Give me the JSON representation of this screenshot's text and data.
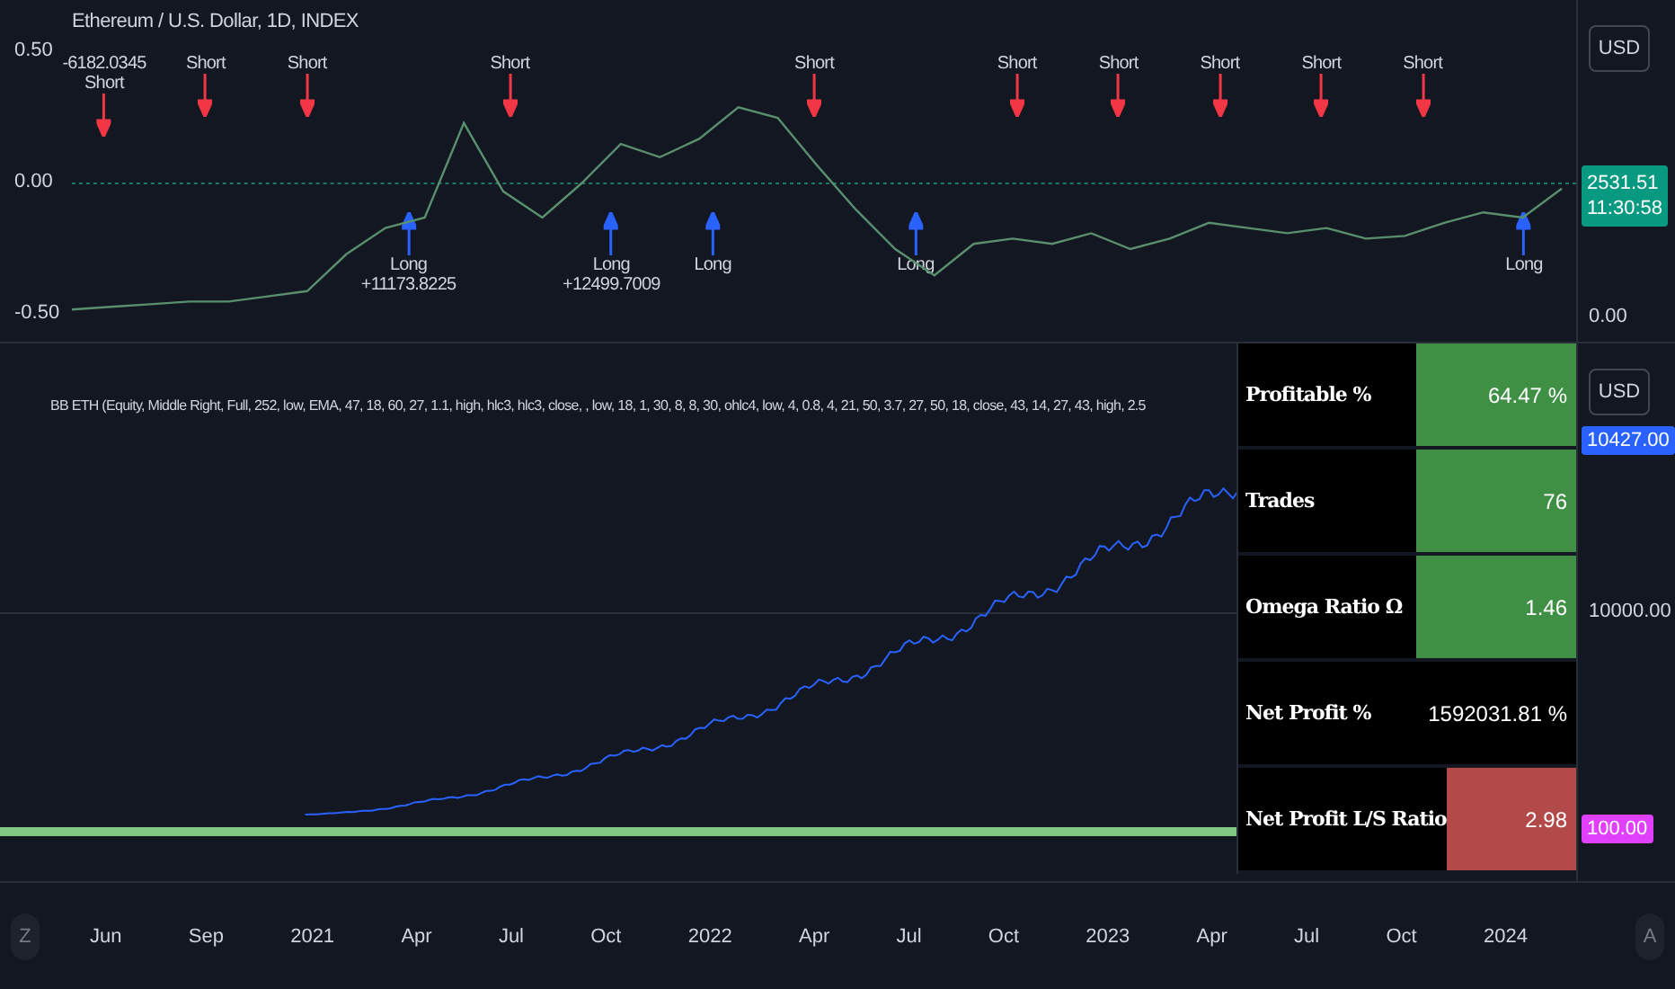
{
  "top_pane": {
    "symbol_legend": "Ethereum / U.S. Dollar, 1D, INDEX",
    "chart_data": {
      "type": "line",
      "ylim": [
        -0.5,
        0.5
      ],
      "yticks": [
        {
          "value": 0.5,
          "label": "0.50"
        },
        {
          "value": 0,
          "label": "0.00"
        },
        {
          "value": -0.5,
          "label": "-0.50"
        }
      ],
      "series": [
        {
          "color": "#5a8f6e",
          "values": [
            -0.48,
            -0.47,
            -0.46,
            -0.45,
            -0.45,
            -0.43,
            -0.41,
            -0.27,
            -0.17,
            -0.13,
            0.23,
            -0.03,
            -0.13,
            0.0,
            0.15,
            0.1,
            0.17,
            0.29,
            0.25,
            0.07,
            -0.1,
            -0.25,
            -0.35,
            -0.23,
            -0.21,
            -0.23,
            -0.19,
            -0.25,
            -0.21,
            -0.15,
            -0.17,
            -0.19,
            -0.17,
            -0.21,
            -0.2,
            -0.15,
            -0.11,
            -0.13,
            -0.02
          ]
        }
      ]
    },
    "currency_button": "USD",
    "price_tag": {
      "price": "2531.51",
      "countdown": "11:30:58"
    },
    "zero_label": "0.00",
    "signals": [
      {
        "kind": "short",
        "label": "Short",
        "pnl": "-6182.0345"
      },
      {
        "kind": "short",
        "label": "Short"
      },
      {
        "kind": "short",
        "label": "Short"
      },
      {
        "kind": "long",
        "label": "Long",
        "pnl": "+11173.8225"
      },
      {
        "kind": "short",
        "label": "Short"
      },
      {
        "kind": "long",
        "label": "Long",
        "pnl": "+12499.7009"
      },
      {
        "kind": "long",
        "label": "Long"
      },
      {
        "kind": "short",
        "label": "Short"
      },
      {
        "kind": "long",
        "label": "Long"
      },
      {
        "kind": "short",
        "label": "Short"
      },
      {
        "kind": "short",
        "label": "Short"
      },
      {
        "kind": "short",
        "label": "Short"
      },
      {
        "kind": "short",
        "label": "Short"
      },
      {
        "kind": "short",
        "label": "Short"
      },
      {
        "kind": "long",
        "label": "Long"
      }
    ]
  },
  "bottom_pane": {
    "indicator_legend": "BB ETH (Equity, Middle Right, Full, 252, low, EMA, 47, 18, 60, 27, 1.1, high, hlc3, hlc3, close, , low, 18, 1, 30, 8, 8, 30, ohlc4, low, 4, 0.8, 4, 21, 50, 3.7, 27, 50, 18, close, 43, 14, 27, 43, high, 2.5",
    "currency_button": "USD",
    "equity_tag": "10427.00",
    "y_tick": "10000.00",
    "baseline_tag": "100.00",
    "stats": [
      {
        "name": "Profitable %",
        "value": "64.47 %",
        "color": "#3f8f45"
      },
      {
        "name": "Trades",
        "value": "76",
        "color": "#3f8f45"
      },
      {
        "name": "Omega Ratio Ω",
        "value": "1.46",
        "color": "#3f8f45"
      },
      {
        "name": "Net Profit %",
        "value": "1592031.81 %",
        "color": "#000000"
      },
      {
        "name": "Net Profit L/S Ratio",
        "value": "2.98",
        "color": "#b24a4a"
      }
    ]
  },
  "time_axis": {
    "zoom_button": "Z",
    "auto_button": "A",
    "labels": [
      "Jun",
      "Sep",
      "2021",
      "Apr",
      "Jul",
      "Oct",
      "2022",
      "Apr",
      "Jul",
      "Oct",
      "2023",
      "Apr",
      "Jul",
      "Oct",
      "2024"
    ]
  }
}
